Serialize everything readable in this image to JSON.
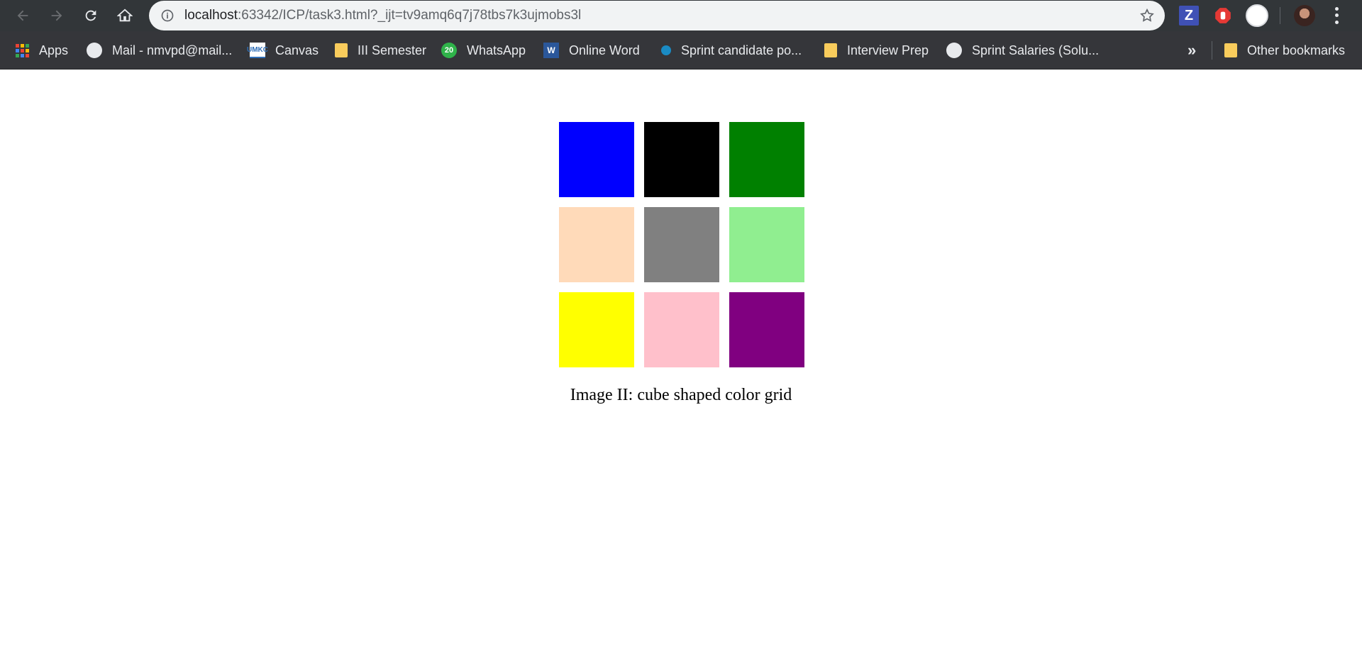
{
  "browser": {
    "url_host": "localhost",
    "url_path": ":63342/ICP/task3.html?_ijt=tv9amq6q7j78tbs7k3ujmobs3l",
    "extensions": {
      "z_label": "Z"
    }
  },
  "bookmarks": {
    "items": [
      {
        "label": "Apps",
        "icon": "apps-grid-icon"
      },
      {
        "label": "Mail - nmvpd@mail...",
        "icon": "globe-icon"
      },
      {
        "label": "Canvas",
        "icon": "canvas-icon"
      },
      {
        "label": "III Semester",
        "icon": "folder-icon"
      },
      {
        "label": "WhatsApp",
        "icon": "whatsapp-icon",
        "badge": "20"
      },
      {
        "label": "Online Word",
        "icon": "word-icon"
      },
      {
        "label": "Sprint candidate po...",
        "icon": "sprint-icon"
      },
      {
        "label": "Interview Prep",
        "icon": "folder-icon"
      },
      {
        "label": "Sprint Salaries (Solu...",
        "icon": "globe-icon"
      }
    ],
    "overflow": "»",
    "other": "Other bookmarks"
  },
  "grid": {
    "colors": [
      "#0000ff",
      "#000000",
      "#008000",
      "#ffdab9",
      "#808080",
      "#90ee90",
      "#ffff00",
      "#ffc0cb",
      "#800080"
    ]
  },
  "caption": "Image II: cube shaped color grid"
}
